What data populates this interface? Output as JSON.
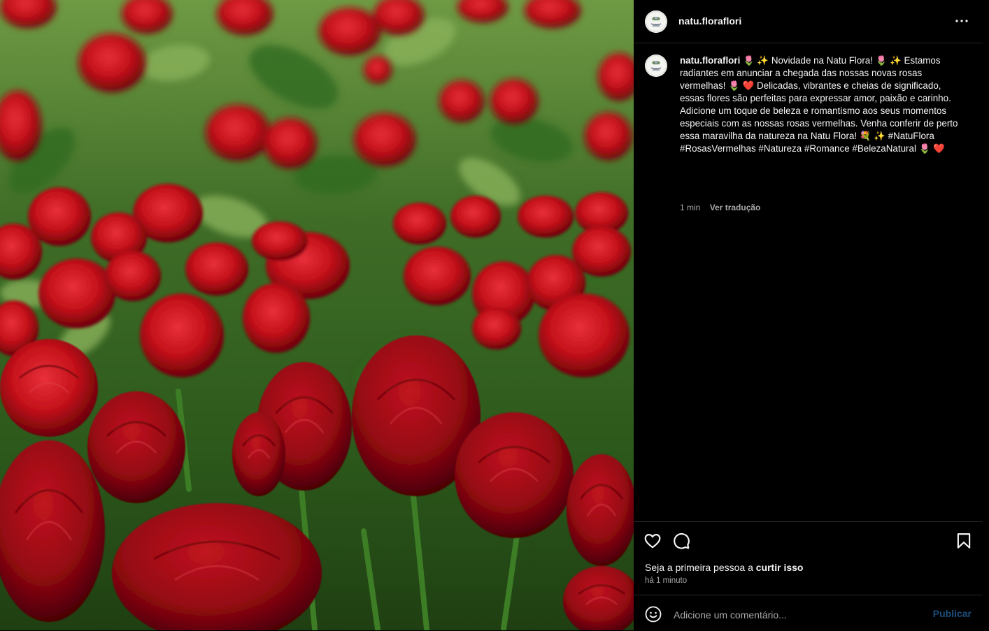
{
  "post": {
    "username": "natu.floraflori",
    "avatar_label": "Natu Flora",
    "caption_segments": [
      "🌷 ✨ Novidade na Natu Flora! 🌷 ✨ Estamos radiantes em anunciar a chegada das nossas novas rosas vermelhas! 🌷 ❤️ Delicadas, vibrantes e cheias de significado, essas flores são perfeitas para expressar amor, paixão e carinho. Adicione um toque de beleza e romantismo aos seus momentos especiais com as nossas rosas vermelhas. Venha conferir de perto essa maravilha da natureza na Natu Flora! 💐 ✨ #NatuFlora #RosasVermelhas #Natureza #Romance #BelezaNatural 🌷 ❤️"
    ],
    "caption_time": "1 min",
    "translate_label": "Ver tradução",
    "likes_prefix": "Seja a primeira pessoa a ",
    "likes_link": "curtir isso",
    "posted_time": "há 1 minuto",
    "image_description_icon": "red-roses-photo"
  },
  "comment_box": {
    "placeholder": "Adicione um comentário...",
    "publish_label": "Publicar"
  },
  "colors": {
    "background": "#000000",
    "text": "#f5f5f5",
    "secondary_text": "#a8a8a8",
    "publish_disabled": "#1e4f7c",
    "rose_red": "#c4111a"
  },
  "icons": {
    "more": "more-horizontal-icon",
    "like": "heart-icon",
    "comment": "comment-bubble-icon",
    "save": "bookmark-icon",
    "emoji": "smiley-icon"
  }
}
